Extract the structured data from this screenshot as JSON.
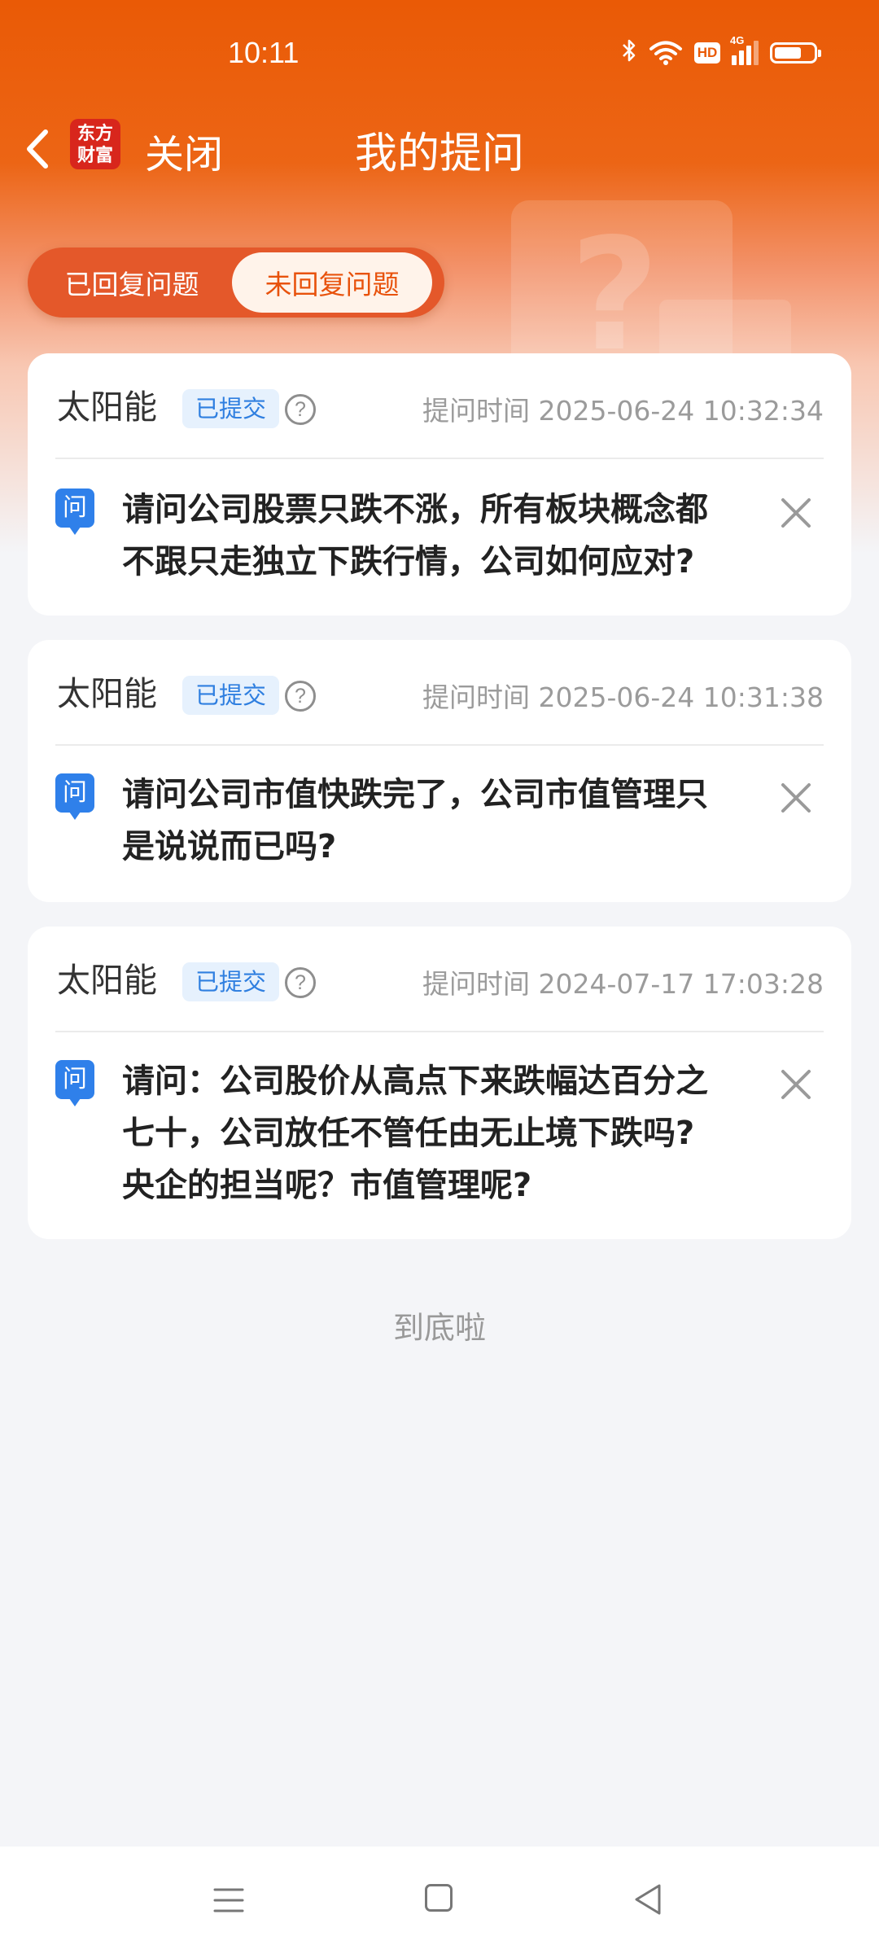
{
  "status_bar": {
    "time": "10:11",
    "bluetooth_icon": "bluetooth-icon",
    "wifi_icon": "wifi-icon",
    "hd_label": "HD",
    "signal_label": "4G",
    "battery_level": 0.7
  },
  "nav": {
    "back_icon": "chevron-left-icon",
    "logo_line1": "东方",
    "logo_line2": "财富",
    "close_label": "关闭",
    "title": "我的提问"
  },
  "tabs": [
    {
      "label": "已回复问题",
      "active": false
    },
    {
      "label": "未回复问题",
      "active": true
    }
  ],
  "questions": [
    {
      "company": "太阳能",
      "status": "已提交",
      "help_glyph": "?",
      "time": "提问时间 2025-06-24 10:32:34",
      "q_icon": "问",
      "lines": [
        "请问公司股票只跌不涨，所有板块概念都",
        "不跟只走独立下跌行情，公司如何应对?"
      ]
    },
    {
      "company": "太阳能",
      "status": "已提交",
      "help_glyph": "?",
      "time": "提问时间 2025-06-24 10:31:38",
      "q_icon": "问",
      "lines": [
        "请问公司市值快跌完了，公司市值管理只",
        "是说说而已吗?"
      ]
    },
    {
      "company": "太阳能",
      "status": "已提交",
      "help_glyph": "?",
      "time": "提问时间 2024-07-17 17:03:28",
      "q_icon": "问",
      "lines": [
        "请问：公司股价从高点下来跌幅达百分之",
        "七十，公司放任不管任由无止境下跌吗?",
        "央企的担当呢？市值管理呢?"
      ]
    }
  ],
  "end_text": "到底啦",
  "system_nav": {
    "menu_icon": "menu-icon",
    "home_icon": "home-square-icon",
    "back_icon": "back-triangle-icon"
  }
}
